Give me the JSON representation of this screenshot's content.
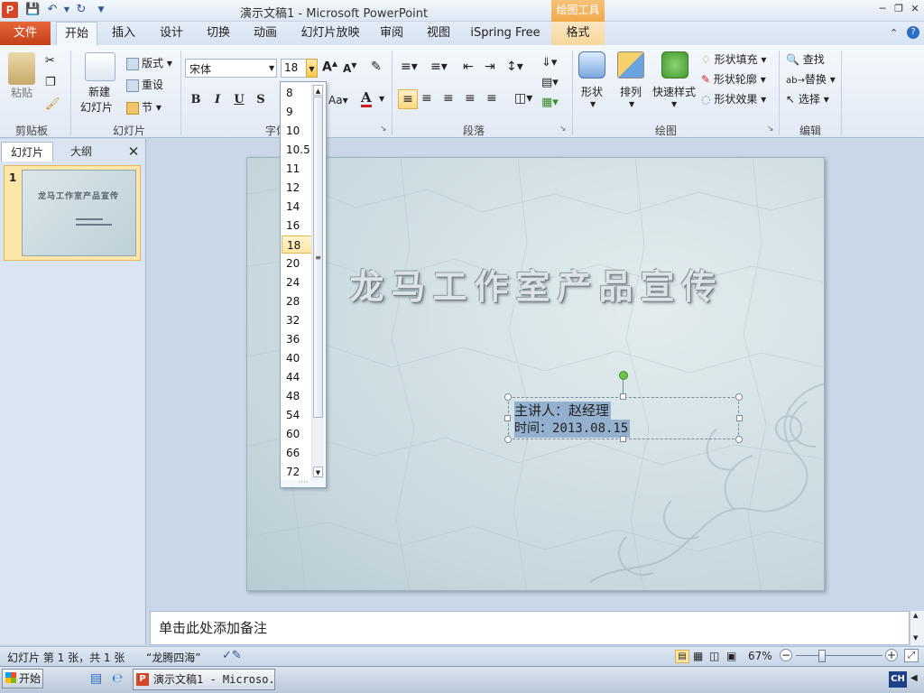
{
  "titlebar": {
    "title": "演示文稿1 - Microsoft PowerPoint",
    "context_tools": "绘图工具",
    "logo": "P"
  },
  "tabs": {
    "file": "文件",
    "home": "开始",
    "insert": "插入",
    "design": "设计",
    "transitions": "切换",
    "animations": "动画",
    "slideshow": "幻灯片放映",
    "review": "审阅",
    "view": "视图",
    "ispring": "iSpring Free",
    "format": "格式"
  },
  "ribbon": {
    "clipboard": {
      "paste": "粘贴",
      "label": "剪贴板"
    },
    "slides": {
      "new_slide_1": "新建",
      "new_slide_2": "幻灯片",
      "layout": "版式",
      "reset": "重设",
      "section": "节",
      "label": "幻灯片"
    },
    "font": {
      "font_name": "宋体",
      "font_size": "18",
      "bold": "B",
      "italic": "I",
      "underline": "U",
      "shadow": "S",
      "label": "字体",
      "aa": "Aa",
      "grow": "A",
      "shrink": "A"
    },
    "paragraph": {
      "label": "段落"
    },
    "drawing": {
      "shape": "形状",
      "arrange": "排列",
      "quick_styles": "快速样式",
      "fill": "形状填充",
      "outline": "形状轮廓",
      "effects": "形状效果",
      "label": "绘图"
    },
    "editing": {
      "find": "查找",
      "replace": "替换",
      "select": "选择",
      "label": "编辑"
    }
  },
  "font_size_list": {
    "items": [
      "8",
      "9",
      "10",
      "10.5",
      "11",
      "12",
      "14",
      "16",
      "18",
      "20",
      "24",
      "28",
      "32",
      "36",
      "40",
      "44",
      "48",
      "54",
      "60",
      "66",
      "72"
    ],
    "selected": "18"
  },
  "left_pane": {
    "tab_slides": "幻灯片",
    "tab_outline": "大纲",
    "thumbnail_number": "1",
    "thumbnail_title": "龙马工作室产品宣传"
  },
  "slide": {
    "title": "龙马工作室产品宣传",
    "presenter": "主讲人：赵经理",
    "date": "时间：2013.08.15"
  },
  "notes": {
    "placeholder": "单击此处添加备注"
  },
  "statusbar": {
    "slide_info": "幻灯片 第 1 张，共 1 张",
    "theme": "“龙腾四海”",
    "zoom": "67%"
  },
  "taskbar": {
    "start": "开始",
    "ppt_task": "演示文稿1 - Microso...",
    "ime": "CH"
  },
  "colors": {
    "file_tab": "#d24726",
    "context_tools": "#f0a848",
    "selection": "#93b0cf"
  }
}
